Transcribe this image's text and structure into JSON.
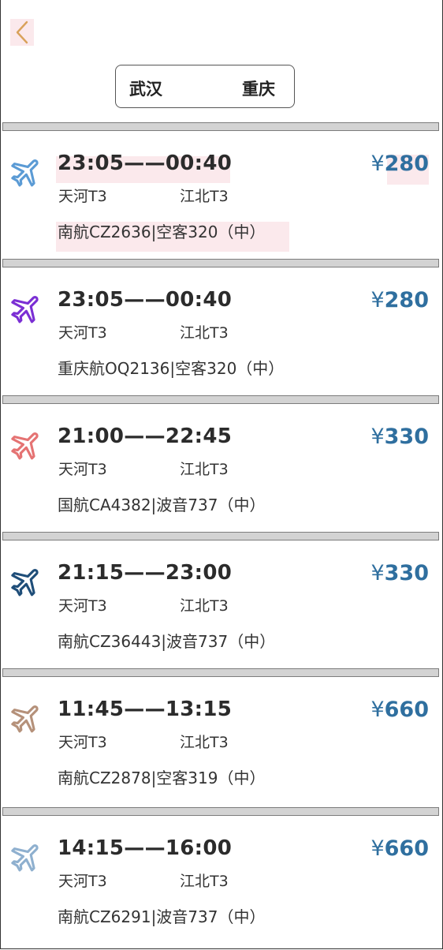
{
  "header": {
    "back_icon": "chevron-left-icon",
    "accent": "#d9a25a"
  },
  "route": {
    "from": "武汉",
    "to": "重庆"
  },
  "flights": [
    {
      "depart": "23:05",
      "arrive": "00:40",
      "dep_terminal": "天河T3",
      "arr_terminal": "江北T3",
      "flight": "南航CZ2636|空客320（中）",
      "price": "280",
      "plane_color": "#5b9bd5"
    },
    {
      "depart": "23:05",
      "arrive": "00:40",
      "dep_terminal": "天河T3",
      "arr_terminal": "江北T3",
      "flight": "重庆航OQ2136|空客320（中）",
      "price": "280",
      "plane_color": "#7b2fd4"
    },
    {
      "depart": "21:00",
      "arrive": "22:45",
      "dep_terminal": "天河T3",
      "arr_terminal": "江北T3",
      "flight": "国航CA4382|波音737（中）",
      "price": "330",
      "plane_color": "#e57373"
    },
    {
      "depart": "21:15",
      "arrive": "23:00",
      "dep_terminal": "天河T3",
      "arr_terminal": "江北T3",
      "flight": "南航CZ36443|波音737（中）",
      "price": "330",
      "plane_color": "#1f4e79"
    },
    {
      "depart": "11:45",
      "arrive": "13:15",
      "dep_terminal": "天河T3",
      "arr_terminal": "江北T3",
      "flight": "南航CZ2878|空客319（中）",
      "price": "660",
      "plane_color": "#b5917a"
    },
    {
      "depart": "14:15",
      "arrive": "16:00",
      "dep_terminal": "天河T3",
      "arr_terminal": "江北T3",
      "flight": "南航CZ6291|波音737（中）",
      "price": "660",
      "plane_color": "#8fb0cf"
    }
  ],
  "currency_symbol": "¥",
  "time_separator": "——"
}
